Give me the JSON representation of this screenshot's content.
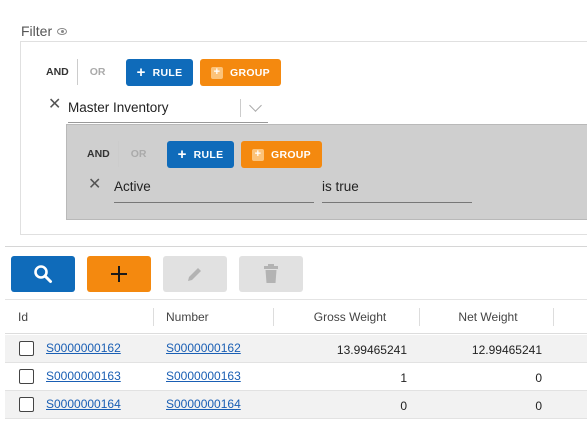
{
  "filter": {
    "title": "Filter",
    "and_label": "AND",
    "or_label": "OR",
    "rule_label": "RULE",
    "group_label": "GROUP",
    "field_select": "Master Inventory",
    "group": {
      "and_label": "AND",
      "or_label": "OR",
      "rule_label": "RULE",
      "group_label": "GROUP",
      "rule_field": "Active",
      "rule_operator": "is true"
    }
  },
  "toolbar": {
    "search_icon": "search-icon",
    "add_icon": "plus-icon",
    "edit_icon": "pencil-icon",
    "delete_icon": "trash-icon"
  },
  "grid": {
    "columns": [
      "Id",
      "Number",
      "Gross Weight",
      "Net Weight"
    ],
    "rows": [
      {
        "id": "S0000000162",
        "number": "S0000000162",
        "gross": "13.99465241",
        "net": "12.99465241"
      },
      {
        "id": "S0000000163",
        "number": "S0000000163",
        "gross": "1",
        "net": "0"
      },
      {
        "id": "S0000000164",
        "number": "S0000000164",
        "gross": "0",
        "net": "0"
      }
    ]
  },
  "colors": {
    "primary": "#0f6bba",
    "accent": "#f4890f",
    "link": "#1a5fb4"
  }
}
